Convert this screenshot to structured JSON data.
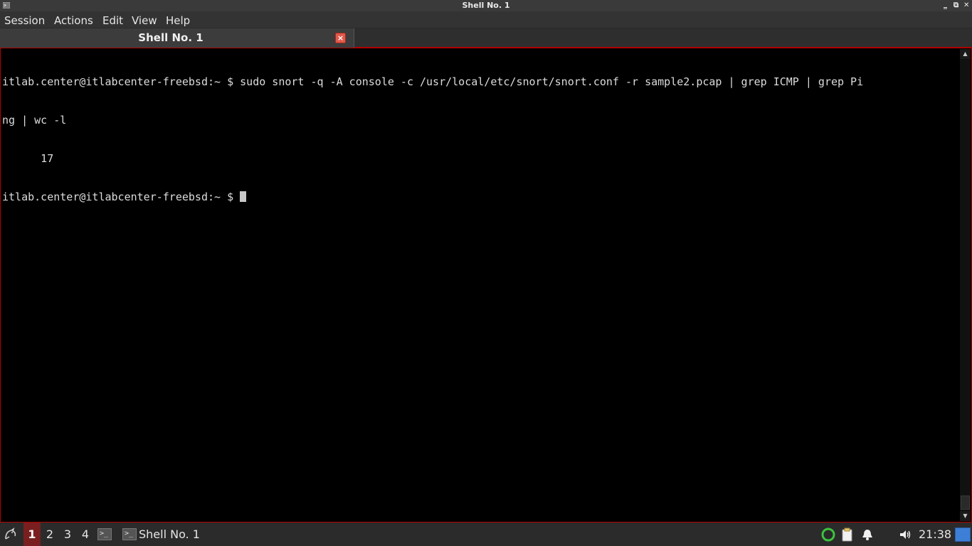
{
  "window": {
    "title": "Shell No. 1",
    "controls": {
      "minimize": "‗",
      "maximize": "⧉",
      "close": "✕"
    }
  },
  "menu": {
    "items": [
      "Session",
      "Actions",
      "Edit",
      "View",
      "Help"
    ]
  },
  "tabs": [
    {
      "label": "Shell No. 1",
      "close_icon": "×"
    }
  ],
  "terminal": {
    "lines": [
      "itlab.center@itlabcenter-freebsd:~ $ sudo snort -q -A console -c /usr/local/etc/snort/snort.conf -r sample2.pcap | grep ICMP | grep Pi",
      "ng | wc -l",
      "      17"
    ],
    "prompt": "itlab.center@itlabcenter-freebsd:~ $ "
  },
  "taskbar": {
    "workspaces": [
      "1",
      "2",
      "3",
      "4"
    ],
    "active_workspace": "1",
    "task_label": "Shell No. 1",
    "clock": "21:38"
  },
  "colors": {
    "accent_border": "#b00000",
    "active_workspace": "#7a1f1f",
    "terminal_bg": "#000000",
    "terminal_fg": "#dcdcdc"
  }
}
